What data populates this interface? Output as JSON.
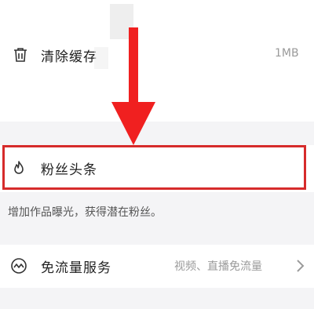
{
  "settings": {
    "clear_cache": {
      "label": "清除缓存",
      "value": "1MB"
    },
    "fans_headline": {
      "label": "粉丝头条",
      "description": "增加作品曝光，获得潜在粉丝。"
    },
    "data_free": {
      "label": "免流量服务",
      "value": "视频、直播免流量"
    }
  },
  "annotation": {
    "arrow_color": "#f02020",
    "box_color": "#d62b2b"
  },
  "icons": {
    "trash": "trash-icon",
    "fire": "fire-icon",
    "wave": "wave-icon",
    "chevron": "chevron-right-icon"
  }
}
